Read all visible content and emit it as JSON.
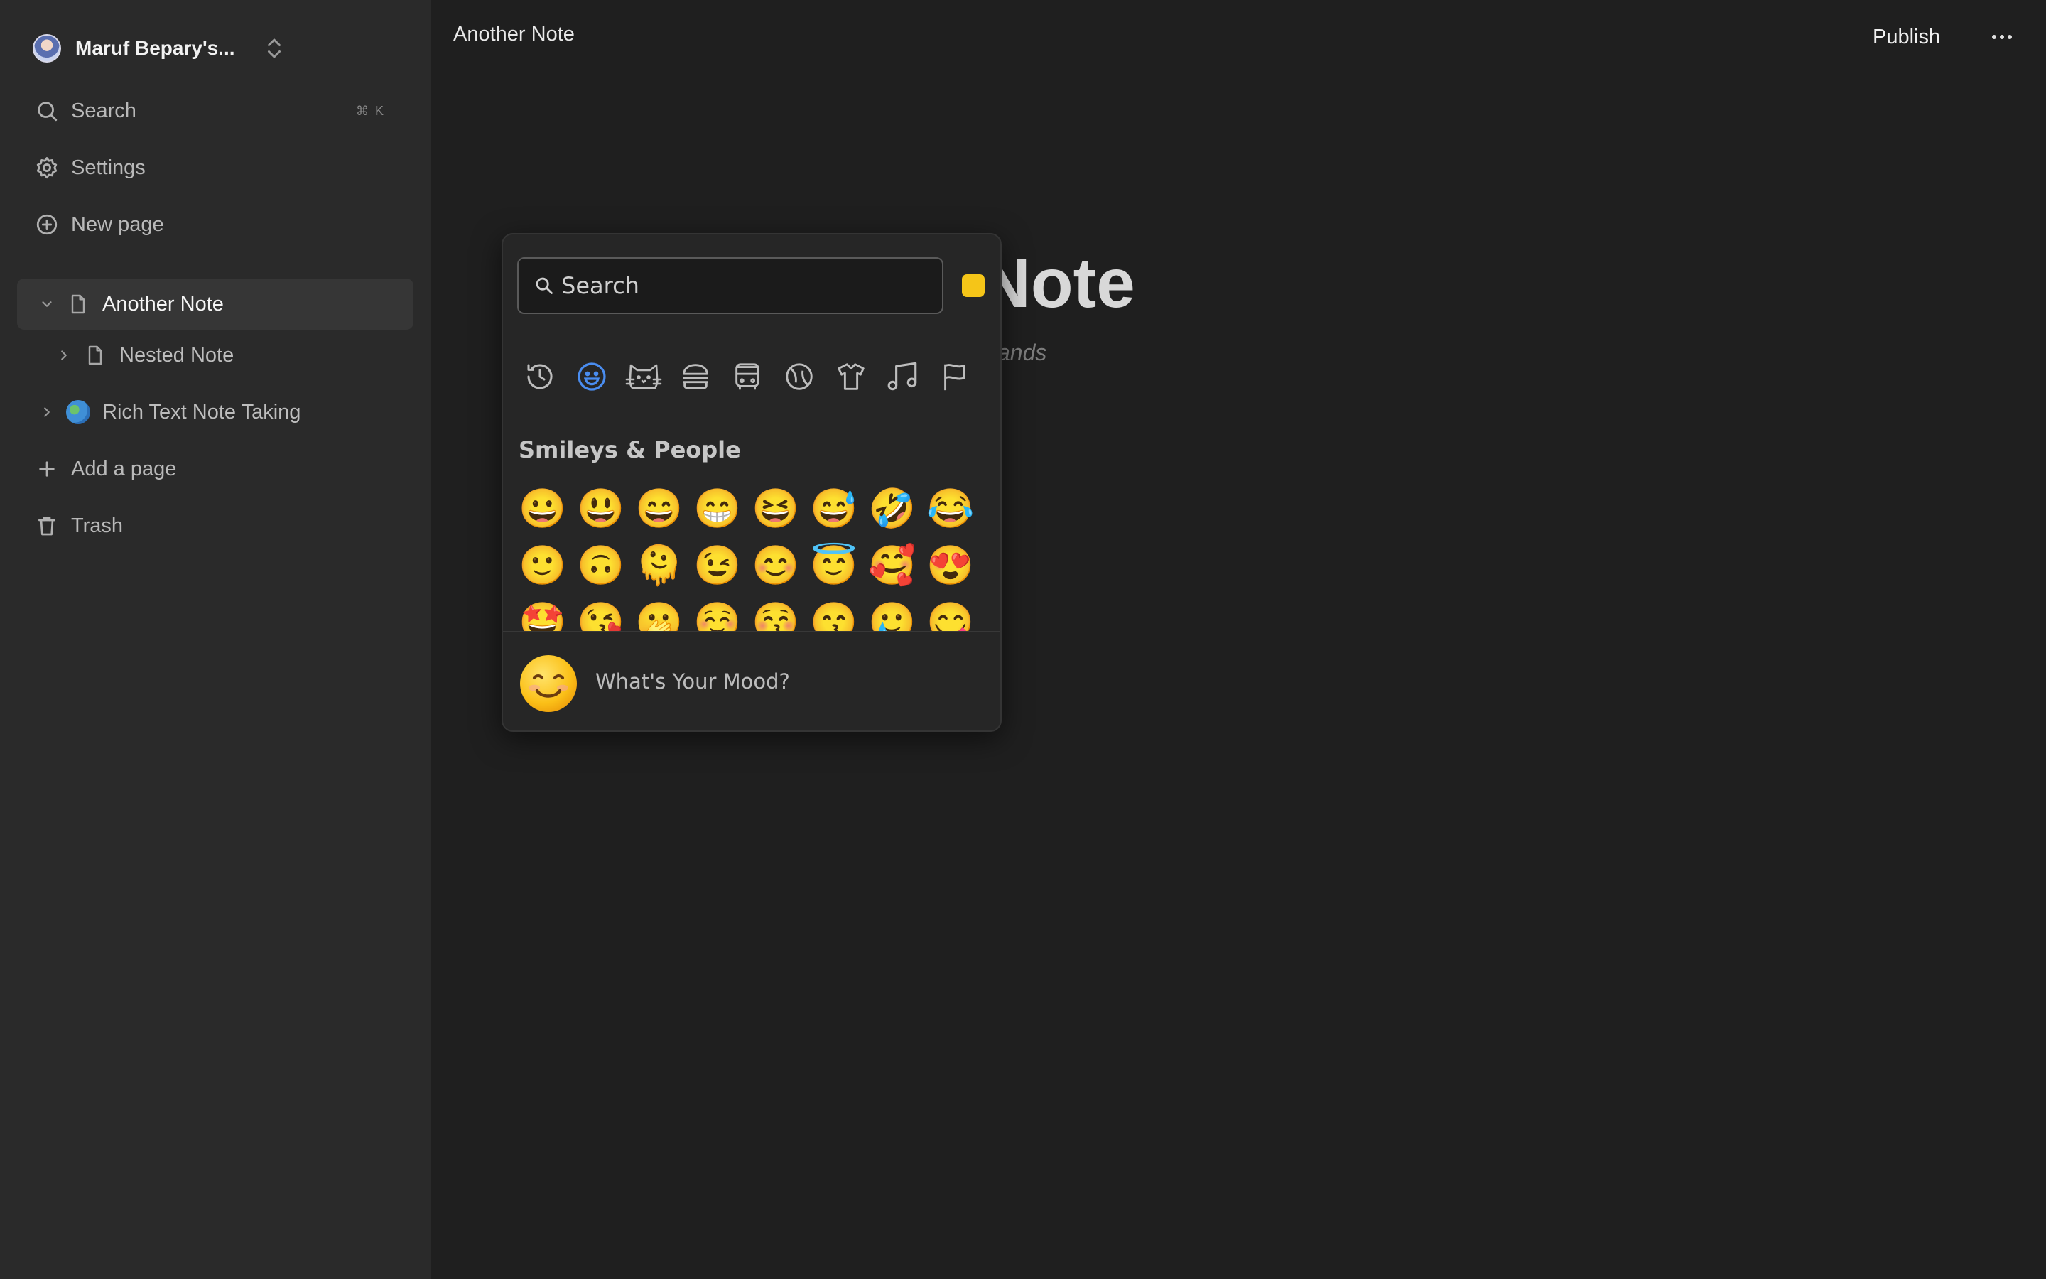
{
  "workspace": {
    "name": "Maruf Bepary's...",
    "avatar_icon": "user-avatar"
  },
  "sidebar": {
    "search_label": "Search",
    "search_shortcut": "⌘ K",
    "settings_label": "Settings",
    "new_page_label": "New page",
    "pages": [
      {
        "label": "Another Note",
        "icon": "page-icon",
        "expanded": true,
        "active": true
      },
      {
        "label": "Nested Note",
        "icon": "page-icon",
        "expanded": false,
        "nested": true
      },
      {
        "label": "Rich Text Note Taking",
        "icon": "globe-emoji",
        "expanded": false
      }
    ],
    "add_page_label": "Add a page",
    "trash_label": "Trash"
  },
  "topbar": {
    "title": "Another Note",
    "publish_label": "Publish",
    "more_icon": "ellipsis-icon"
  },
  "document": {
    "title_visible": "Note",
    "hint_visible": "ands"
  },
  "emoji_picker": {
    "search_placeholder": "Search",
    "skin_tone_color": "#f5c518",
    "selected_category": "smileys",
    "categories": [
      "recent-clock-icon",
      "smiley-icon",
      "cat-icon",
      "burger-icon",
      "bus-icon",
      "ball-icon",
      "shirt-icon",
      "music-icon",
      "flag-icon"
    ],
    "section_title": "Smileys & People",
    "emojis": [
      "😀",
      "😃",
      "😄",
      "😁",
      "😆",
      "😅",
      "🤣",
      "😂",
      "🙂",
      "🙃",
      "🫠",
      "😉",
      "😊",
      "😇",
      "🥰",
      "😍",
      "🤩",
      "😘",
      "🫢",
      "☺️",
      "😚",
      "😙",
      "🥲",
      "😋"
    ],
    "footer_text": "What's Your Mood?"
  },
  "colors": {
    "accent": "#4a8df0",
    "sidebar_bg": "#2a2a2a",
    "page_bg": "#1f1f1f"
  }
}
